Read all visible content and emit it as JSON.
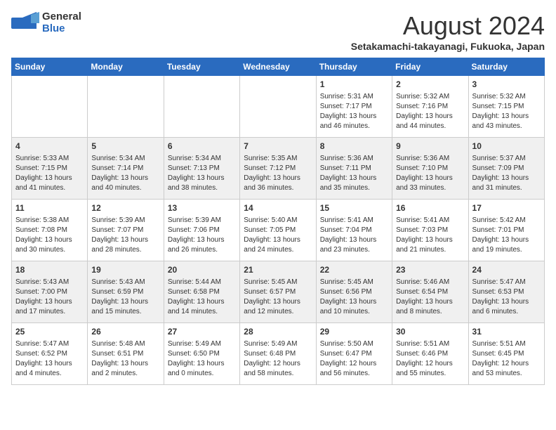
{
  "header": {
    "logo_line1": "General",
    "logo_line2": "Blue",
    "month_year": "August 2024",
    "location": "Setakamachi-takayanagi, Fukuoka, Japan"
  },
  "weekdays": [
    "Sunday",
    "Monday",
    "Tuesday",
    "Wednesday",
    "Thursday",
    "Friday",
    "Saturday"
  ],
  "weeks": [
    [
      {
        "day": "",
        "info": ""
      },
      {
        "day": "",
        "info": ""
      },
      {
        "day": "",
        "info": ""
      },
      {
        "day": "",
        "info": ""
      },
      {
        "day": "1",
        "info": "Sunrise: 5:31 AM\nSunset: 7:17 PM\nDaylight: 13 hours\nand 46 minutes."
      },
      {
        "day": "2",
        "info": "Sunrise: 5:32 AM\nSunset: 7:16 PM\nDaylight: 13 hours\nand 44 minutes."
      },
      {
        "day": "3",
        "info": "Sunrise: 5:32 AM\nSunset: 7:15 PM\nDaylight: 13 hours\nand 43 minutes."
      }
    ],
    [
      {
        "day": "4",
        "info": "Sunrise: 5:33 AM\nSunset: 7:15 PM\nDaylight: 13 hours\nand 41 minutes."
      },
      {
        "day": "5",
        "info": "Sunrise: 5:34 AM\nSunset: 7:14 PM\nDaylight: 13 hours\nand 40 minutes."
      },
      {
        "day": "6",
        "info": "Sunrise: 5:34 AM\nSunset: 7:13 PM\nDaylight: 13 hours\nand 38 minutes."
      },
      {
        "day": "7",
        "info": "Sunrise: 5:35 AM\nSunset: 7:12 PM\nDaylight: 13 hours\nand 36 minutes."
      },
      {
        "day": "8",
        "info": "Sunrise: 5:36 AM\nSunset: 7:11 PM\nDaylight: 13 hours\nand 35 minutes."
      },
      {
        "day": "9",
        "info": "Sunrise: 5:36 AM\nSunset: 7:10 PM\nDaylight: 13 hours\nand 33 minutes."
      },
      {
        "day": "10",
        "info": "Sunrise: 5:37 AM\nSunset: 7:09 PM\nDaylight: 13 hours\nand 31 minutes."
      }
    ],
    [
      {
        "day": "11",
        "info": "Sunrise: 5:38 AM\nSunset: 7:08 PM\nDaylight: 13 hours\nand 30 minutes."
      },
      {
        "day": "12",
        "info": "Sunrise: 5:39 AM\nSunset: 7:07 PM\nDaylight: 13 hours\nand 28 minutes."
      },
      {
        "day": "13",
        "info": "Sunrise: 5:39 AM\nSunset: 7:06 PM\nDaylight: 13 hours\nand 26 minutes."
      },
      {
        "day": "14",
        "info": "Sunrise: 5:40 AM\nSunset: 7:05 PM\nDaylight: 13 hours\nand 24 minutes."
      },
      {
        "day": "15",
        "info": "Sunrise: 5:41 AM\nSunset: 7:04 PM\nDaylight: 13 hours\nand 23 minutes."
      },
      {
        "day": "16",
        "info": "Sunrise: 5:41 AM\nSunset: 7:03 PM\nDaylight: 13 hours\nand 21 minutes."
      },
      {
        "day": "17",
        "info": "Sunrise: 5:42 AM\nSunset: 7:01 PM\nDaylight: 13 hours\nand 19 minutes."
      }
    ],
    [
      {
        "day": "18",
        "info": "Sunrise: 5:43 AM\nSunset: 7:00 PM\nDaylight: 13 hours\nand 17 minutes."
      },
      {
        "day": "19",
        "info": "Sunrise: 5:43 AM\nSunset: 6:59 PM\nDaylight: 13 hours\nand 15 minutes."
      },
      {
        "day": "20",
        "info": "Sunrise: 5:44 AM\nSunset: 6:58 PM\nDaylight: 13 hours\nand 14 minutes."
      },
      {
        "day": "21",
        "info": "Sunrise: 5:45 AM\nSunset: 6:57 PM\nDaylight: 13 hours\nand 12 minutes."
      },
      {
        "day": "22",
        "info": "Sunrise: 5:45 AM\nSunset: 6:56 PM\nDaylight: 13 hours\nand 10 minutes."
      },
      {
        "day": "23",
        "info": "Sunrise: 5:46 AM\nSunset: 6:54 PM\nDaylight: 13 hours\nand 8 minutes."
      },
      {
        "day": "24",
        "info": "Sunrise: 5:47 AM\nSunset: 6:53 PM\nDaylight: 13 hours\nand 6 minutes."
      }
    ],
    [
      {
        "day": "25",
        "info": "Sunrise: 5:47 AM\nSunset: 6:52 PM\nDaylight: 13 hours\nand 4 minutes."
      },
      {
        "day": "26",
        "info": "Sunrise: 5:48 AM\nSunset: 6:51 PM\nDaylight: 13 hours\nand 2 minutes."
      },
      {
        "day": "27",
        "info": "Sunrise: 5:49 AM\nSunset: 6:50 PM\nDaylight: 13 hours\nand 0 minutes."
      },
      {
        "day": "28",
        "info": "Sunrise: 5:49 AM\nSunset: 6:48 PM\nDaylight: 12 hours\nand 58 minutes."
      },
      {
        "day": "29",
        "info": "Sunrise: 5:50 AM\nSunset: 6:47 PM\nDaylight: 12 hours\nand 56 minutes."
      },
      {
        "day": "30",
        "info": "Sunrise: 5:51 AM\nSunset: 6:46 PM\nDaylight: 12 hours\nand 55 minutes."
      },
      {
        "day": "31",
        "info": "Sunrise: 5:51 AM\nSunset: 6:45 PM\nDaylight: 12 hours\nand 53 minutes."
      }
    ]
  ]
}
